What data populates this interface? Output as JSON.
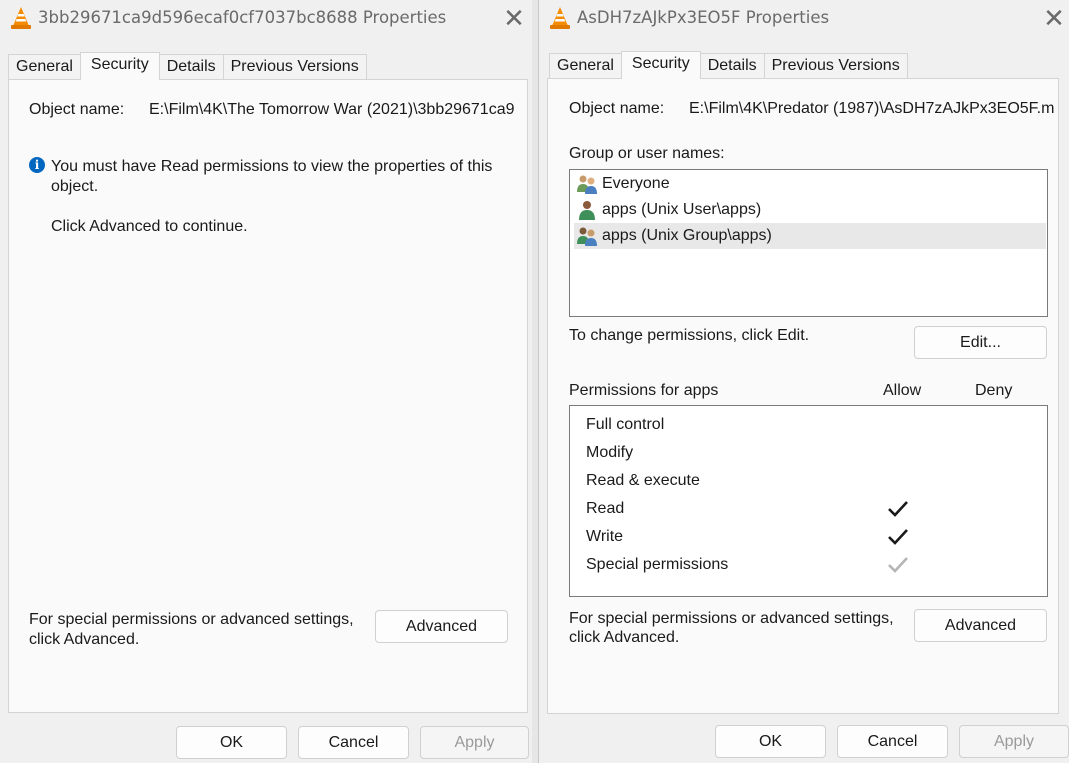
{
  "left": {
    "title": "3bb29671ca9d596ecaf0cf7037bc8688 Properties",
    "tabs": [
      "General",
      "Security",
      "Details",
      "Previous Versions"
    ],
    "object_name_label": "Object name:",
    "object_name_value": "E:\\Film\\4K\\The Tomorrow War (2021)\\3bb29671ca9",
    "info_line1": "You must have Read permissions to view the properties of this",
    "info_line2": "object.",
    "click_advanced": "Click Advanced to continue.",
    "special_line1": "For special permissions or advanced settings,",
    "special_line2": "click Advanced.",
    "advanced_label": "Advanced",
    "ok_label": "OK",
    "cancel_label": "Cancel",
    "apply_label": "Apply"
  },
  "right": {
    "title": "AsDH7zAJkPx3EO5F Properties",
    "tabs": [
      "General",
      "Security",
      "Details",
      "Previous Versions"
    ],
    "object_name_label": "Object name:",
    "object_name_value": "E:\\Film\\4K\\Predator (1987)\\AsDH7zAJkPx3EO5F.m",
    "group_label": "Group or user names:",
    "users": [
      {
        "name": "Everyone",
        "icon": "group-icon"
      },
      {
        "name": "apps (Unix User\\apps)",
        "icon": "user-icon"
      },
      {
        "name": "apps (Unix Group\\apps)",
        "icon": "group-icon",
        "selected": true
      }
    ],
    "change_text": "To change permissions, click Edit.",
    "edit_label": "Edit...",
    "permissions_for": "Permissions for apps",
    "allow_label": "Allow",
    "deny_label": "Deny",
    "permissions": [
      {
        "name": "Full control",
        "allow": "none"
      },
      {
        "name": "Modify",
        "allow": "none"
      },
      {
        "name": "Read & execute",
        "allow": "none"
      },
      {
        "name": "Read",
        "allow": "checked"
      },
      {
        "name": "Write",
        "allow": "checked"
      },
      {
        "name": "Special permissions",
        "allow": "inherited"
      }
    ],
    "special_line1": "For special permissions or advanced settings,",
    "special_line2": "click Advanced.",
    "advanced_label": "Advanced",
    "ok_label": "OK",
    "cancel_label": "Cancel",
    "apply_label": "Apply"
  },
  "colors": {
    "info_blue": "#0067c0",
    "check_dark": "#1a1a1a",
    "check_disabled": "#b5b5b5"
  }
}
